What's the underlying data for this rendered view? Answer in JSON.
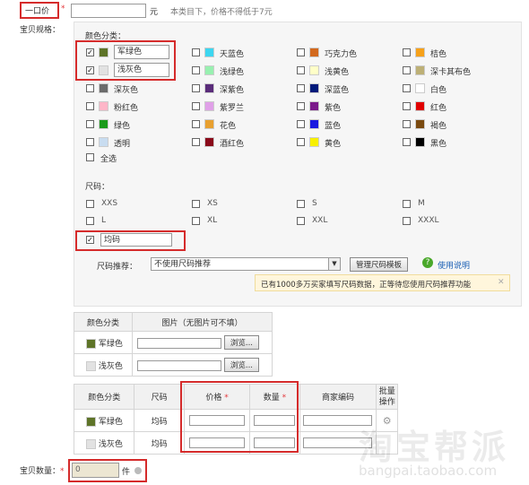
{
  "price": {
    "label": "一口价",
    "unit": "元",
    "hint": "本类目下，价格不得低于7元"
  },
  "spec_label": "宝贝规格",
  "color_section": {
    "title": "颜色分类",
    "colors": [
      {
        "label": "军绿色",
        "color": "#5e7428",
        "checked": true
      },
      {
        "label": "天蓝色",
        "color": "#3dd6f0",
        "checked": false
      },
      {
        "label": "巧克力色",
        "color": "#d2691e",
        "checked": false
      },
      {
        "label": "桔色",
        "color": "#f6a11a",
        "checked": false
      },
      {
        "label": "浅灰色",
        "color": "#e2e2e2",
        "checked": true
      },
      {
        "label": "浅绿色",
        "color": "#98f0b0",
        "checked": false
      },
      {
        "label": "浅黄色",
        "color": "#ffffc8",
        "checked": false
      },
      {
        "label": "深卡其布色",
        "color": "#bdb076",
        "checked": false
      },
      {
        "label": "深灰色",
        "color": "#6b6b6b",
        "checked": false
      },
      {
        "label": "深紫色",
        "color": "#5a2c7a",
        "checked": false
      },
      {
        "label": "深蓝色",
        "color": "#001a7a",
        "checked": false
      },
      {
        "label": "白色",
        "color": "#ffffff",
        "checked": false
      },
      {
        "label": "粉红色",
        "color": "#ffb6c8",
        "checked": false
      },
      {
        "label": "紫罗兰",
        "color": "#e0a0e8",
        "checked": false
      },
      {
        "label": "紫色",
        "color": "#7a1a8a",
        "checked": false
      },
      {
        "label": "红色",
        "color": "#e00000",
        "checked": false
      },
      {
        "label": "绿色",
        "color": "#1a9a1a",
        "checked": false
      },
      {
        "label": "花色",
        "color": "#e8a030",
        "checked": false
      },
      {
        "label": "蓝色",
        "color": "#1a1ae0",
        "checked": false
      },
      {
        "label": "褐色",
        "color": "#7a4a10",
        "checked": false
      },
      {
        "label": "透明",
        "color": "#c8dcf0",
        "checked": false
      },
      {
        "label": "酒红色",
        "color": "#8a0a1a",
        "checked": false
      },
      {
        "label": "黄色",
        "color": "#f8f000",
        "checked": false
      },
      {
        "label": "黑色",
        "color": "#000000",
        "checked": false
      }
    ],
    "select_all": "全选"
  },
  "size_section": {
    "title": "尺码",
    "sizes": [
      {
        "label": "XXS",
        "checked": false
      },
      {
        "label": "XS",
        "checked": false
      },
      {
        "label": "S",
        "checked": false
      },
      {
        "label": "M",
        "checked": false
      },
      {
        "label": "L",
        "checked": false
      },
      {
        "label": "XL",
        "checked": false
      },
      {
        "label": "XXL",
        "checked": false
      },
      {
        "label": "XXXL",
        "checked": false
      }
    ],
    "one_size": {
      "label": "均码",
      "checked": true
    },
    "recommend_label": "尺码推荐",
    "recommend_value": "不使用尺码推荐",
    "manage_button": "管理尺码模板",
    "help_link": "使用说明",
    "notice": "已有1000多万买家填写尺码数据，正等待您使用尺码推荐功能"
  },
  "image_table": {
    "headers": [
      "颜色分类",
      "图片（无图片可不填）"
    ],
    "rows": [
      {
        "color": "#5e7428",
        "name": "军绿色",
        "browse": "浏览..."
      },
      {
        "color": "#e2e2e2",
        "name": "浅灰色",
        "browse": "浏览..."
      }
    ]
  },
  "sku_table": {
    "headers": [
      "颜色分类",
      "尺码",
      "价格",
      "数量",
      "商家编码",
      "批量操作"
    ],
    "rows": [
      {
        "color": "#5e7428",
        "name": "军绿色",
        "size": "均码"
      },
      {
        "color": "#e2e2e2",
        "name": "浅灰色",
        "size": "均码"
      }
    ]
  },
  "quantity": {
    "label": "宝贝数量",
    "value": "0",
    "unit": "件"
  },
  "watermark": {
    "logo": "淘宝帮派",
    "url": "bangpai.taobao.com"
  }
}
